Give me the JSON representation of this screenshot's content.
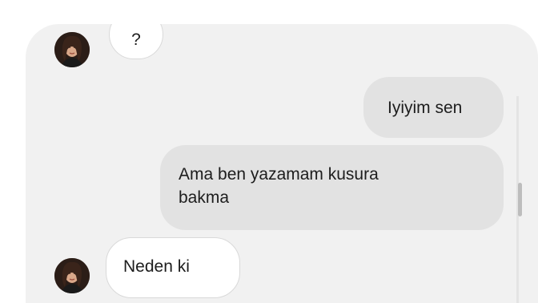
{
  "conversation": {
    "messages": [
      {
        "sender": "contact",
        "text": "?"
      },
      {
        "sender": "me",
        "text": "Iyiyim sen"
      },
      {
        "sender": "me",
        "text": "Ama ben yazamam kusura bakma"
      },
      {
        "sender": "contact",
        "text": "Neden ki"
      }
    ]
  },
  "colors": {
    "panel_background": "#f1f1f1",
    "incoming_bubble": "#ffffff",
    "outgoing_bubble": "#e2e2e2",
    "text": "#1d1d1d"
  },
  "icons": {
    "contact_avatar": "profile-photo-icon"
  }
}
